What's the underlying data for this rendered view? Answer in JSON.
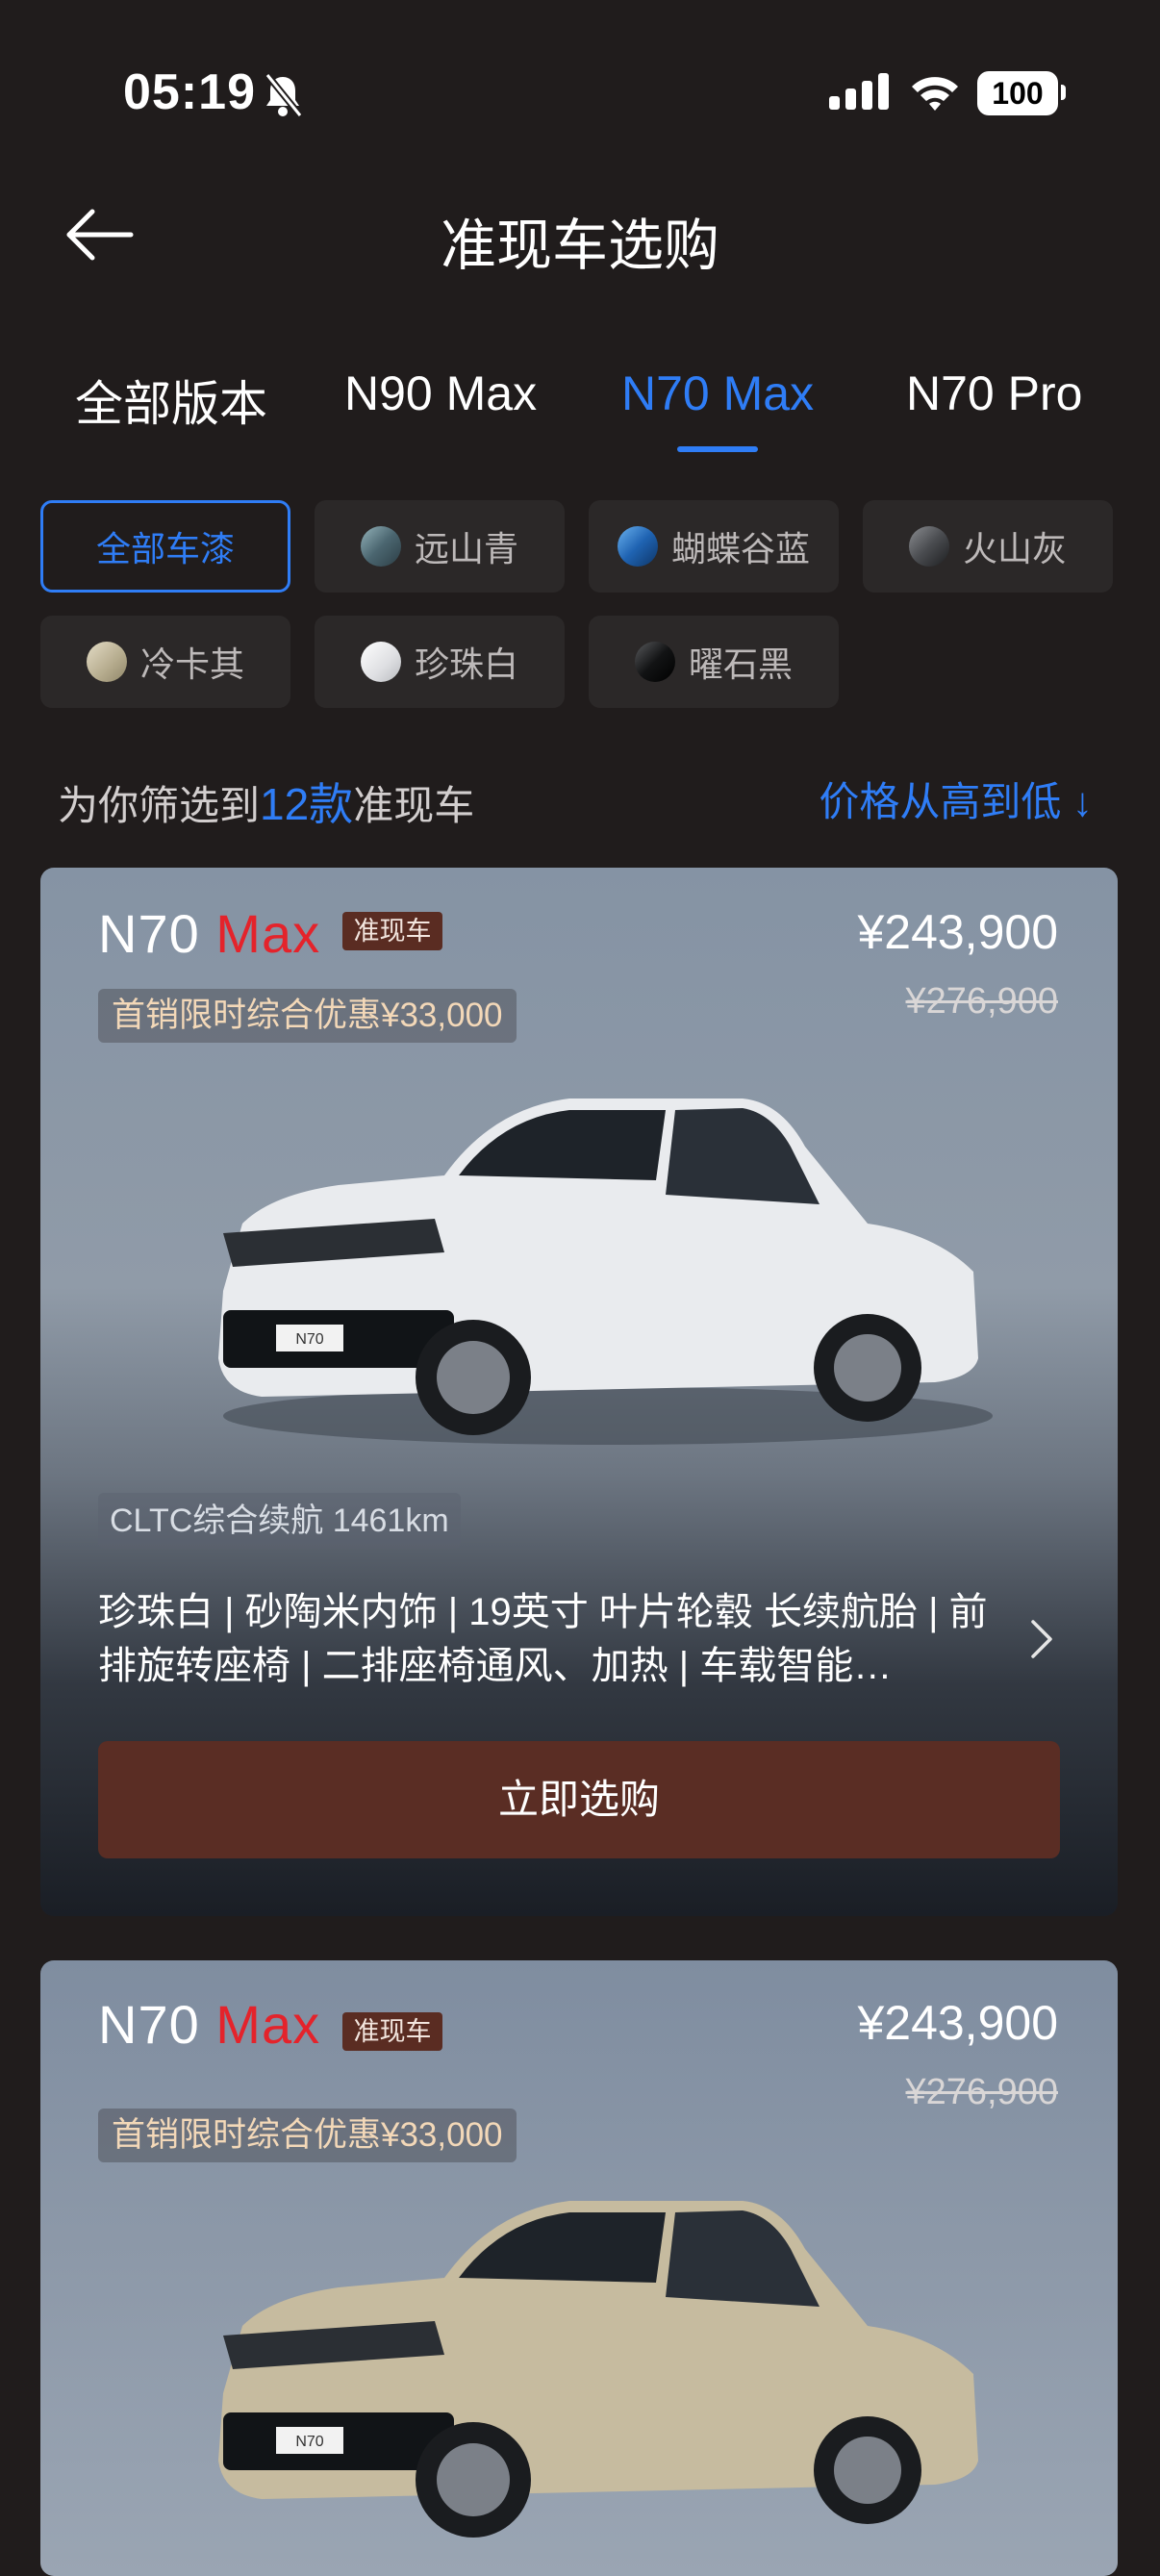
{
  "status": {
    "time": "05:19",
    "battery": "100"
  },
  "header": {
    "title": "准现车选购"
  },
  "tabs": [
    {
      "label": "全部版本"
    },
    {
      "label": "N90 Max"
    },
    {
      "label": "N70 Max",
      "active": true
    },
    {
      "label": "N70 Pro"
    }
  ],
  "colors": [
    {
      "label": "全部车漆",
      "active": true
    },
    {
      "label": "远山青",
      "swatch": "#6f8c95"
    },
    {
      "label": "蝴蝶谷蓝",
      "swatch": "#2b6fb3"
    },
    {
      "label": "火山灰",
      "swatch": "#55575b"
    },
    {
      "label": "冷卡其",
      "swatch": "#c2b89c"
    },
    {
      "label": "珍珠白",
      "swatch": "#e8e8ea"
    },
    {
      "label": "曜石黑",
      "swatch": "#111214"
    }
  ],
  "filter": {
    "prefix": "为你筛选到",
    "count": "12款",
    "suffix": "准现车",
    "sort": "价格从高到低 ↓"
  },
  "cards": [
    {
      "model_n": "N70",
      "model_m": "Max",
      "badge": "准现车",
      "price": "¥243,900",
      "old_price": "¥276,900",
      "promo": "首销限时综合优惠¥33,000",
      "range": "CLTC综合续航 1461km",
      "specs": "珍珠白 | 砂陶米内饰 | 19英寸 叶片轮毂 长续航胎 | 前排旋转座椅 | 二排座椅通风、加热 | 车载智能…",
      "plate": "N70",
      "cta": "立即选购",
      "car_color": "#e9ebee"
    },
    {
      "model_n": "N70",
      "model_m": "Max",
      "badge": "准现车",
      "price": "¥243,900",
      "old_price": "¥276,900",
      "promo": "首销限时综合优惠¥33,000",
      "plate": "N70",
      "car_color": "#c6bb9f"
    }
  ]
}
